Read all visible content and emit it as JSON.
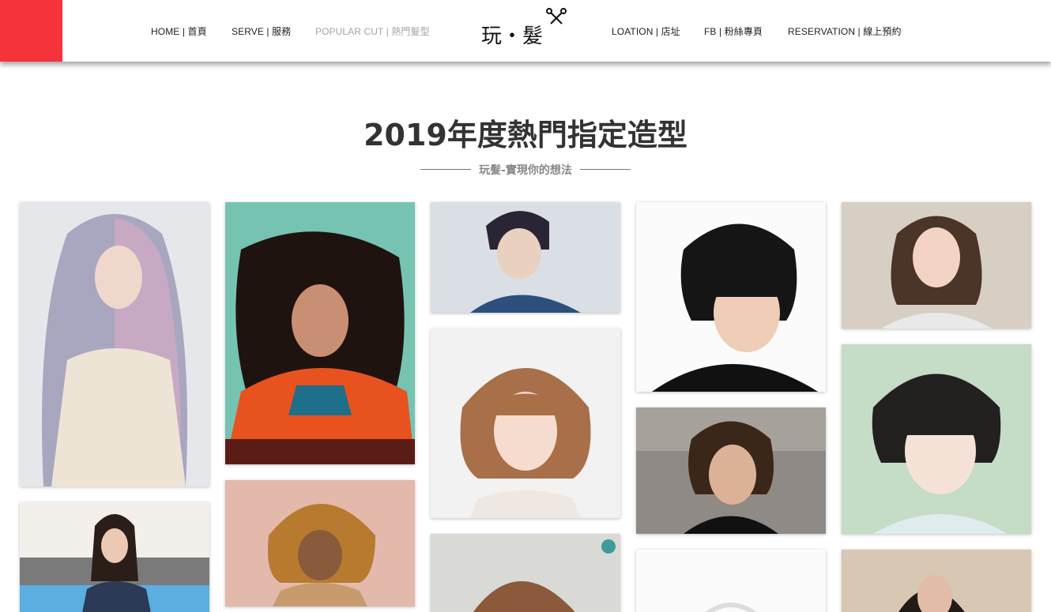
{
  "nav": {
    "items": [
      {
        "label": "HOME | 首頁",
        "active": false
      },
      {
        "label": "SERVE | 服務",
        "active": false
      },
      {
        "label": "POPULAR CUT | 熱門髮型",
        "active": true
      },
      {
        "label": "LOATION | 店址",
        "active": false
      },
      {
        "label": "FB | 粉絲專頁",
        "active": false
      },
      {
        "label": "RESERVATION | 線上預約",
        "active": false
      }
    ],
    "logo_text": "玩・髮",
    "accent_color": "#f6323a"
  },
  "page": {
    "title": "2019年度熱門指定造型",
    "subtitle": "玩髮-實現你的想法"
  },
  "gallery": {
    "photos": [
      "hairstyle-photo-silver-lavender-long-hair",
      "hairstyle-photo-dark-curly-hair",
      "hairstyle-photo-short-textured-cut",
      "hairstyle-photo-wavy-bob-with-bangs",
      "hairstyle-photo-mens-short-shaggy",
      "hairstyle-photo-mens-wavy-medium",
      "hairstyle-photo-medium-wavy-with-bangs",
      "hairstyle-photo-mens-layered-shag",
      "hairstyle-photo-shoulder-length-straight",
      "hairstyle-photo-golden-curly-afro",
      "hairstyle-photo-curly-brown-partial",
      "hairstyle-photo-white-placeholder",
      "hairstyle-photo-long-dark-waves"
    ]
  }
}
